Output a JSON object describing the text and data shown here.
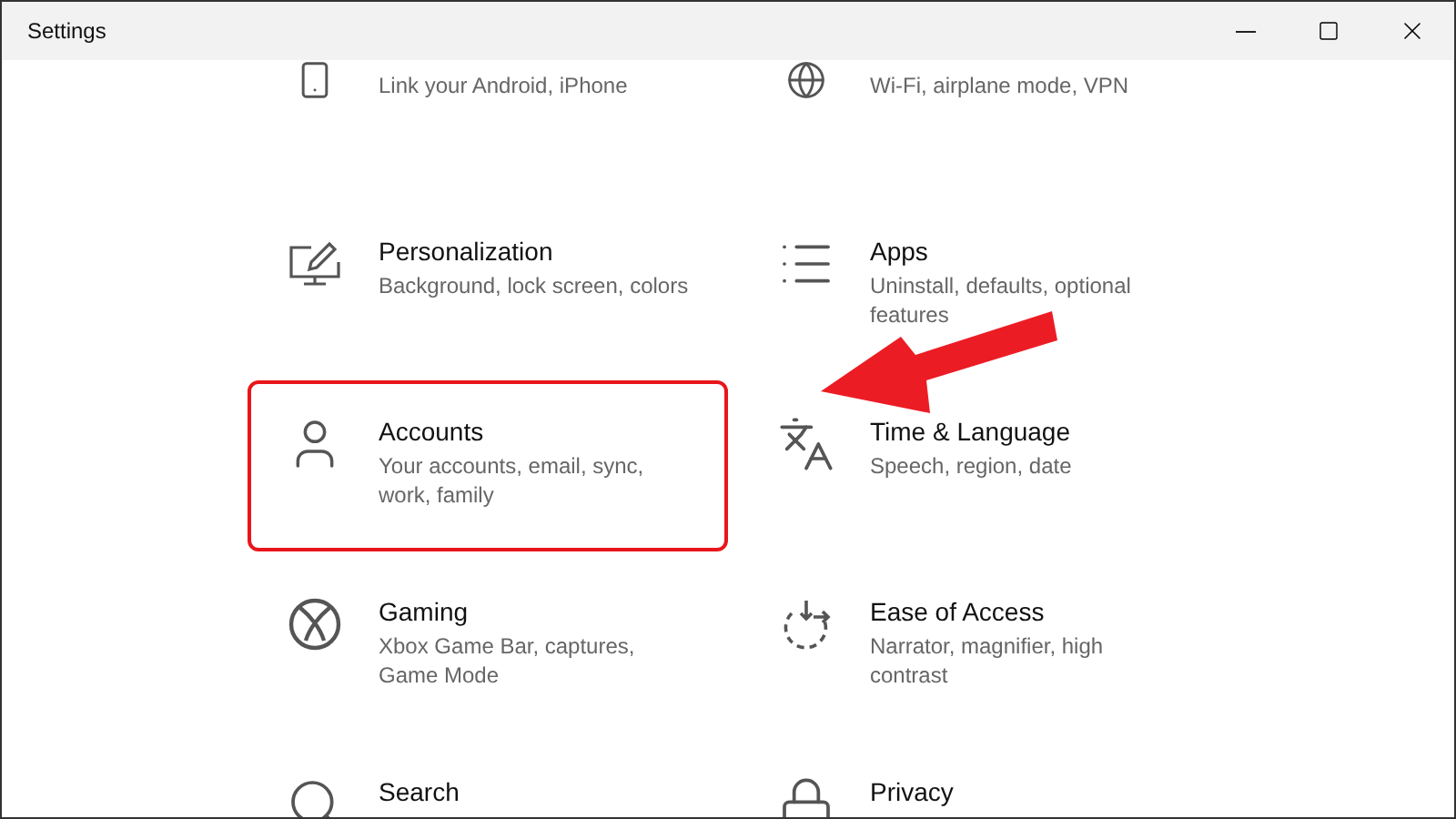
{
  "window": {
    "title": "Settings"
  },
  "items": [
    {
      "kind": "phone",
      "description": "Link your Android, iPhone",
      "highlighted": false
    },
    {
      "kind": "globe",
      "description": "Wi-Fi, airplane mode, VPN",
      "highlighted": false
    },
    {
      "kind": "personalization",
      "title": "Personalization",
      "description": "Background, lock screen, colors",
      "highlighted": false
    },
    {
      "kind": "apps",
      "title": "Apps",
      "description": "Uninstall, defaults, optional features",
      "highlighted": false
    },
    {
      "kind": "accounts",
      "title": "Accounts",
      "description": "Your accounts, email, sync, work, family",
      "highlighted": true
    },
    {
      "kind": "time",
      "title": "Time & Language",
      "description": "Speech, region, date",
      "highlighted": false
    },
    {
      "kind": "gaming",
      "title": "Gaming",
      "description": "Xbox Game Bar, captures, Game Mode",
      "highlighted": false
    },
    {
      "kind": "ease",
      "title": "Ease of Access",
      "description": "Narrator, magnifier, high contrast",
      "highlighted": false
    },
    {
      "kind": "search",
      "title": "Search",
      "highlighted": false
    },
    {
      "kind": "privacy",
      "title": "Privacy",
      "highlighted": false
    }
  ]
}
